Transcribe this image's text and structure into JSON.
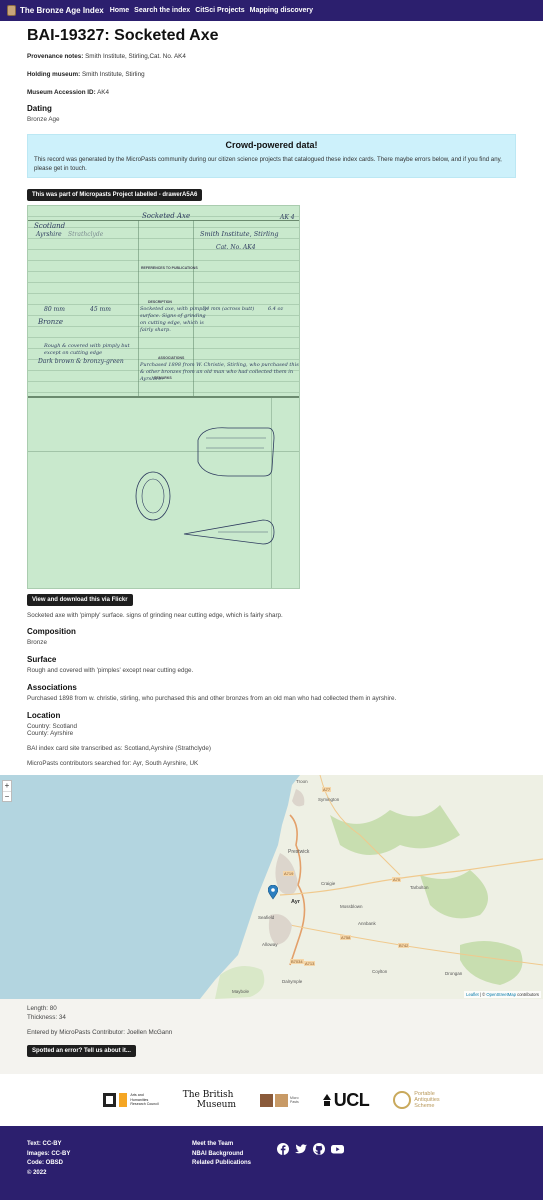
{
  "navbar": {
    "brand": "The Bronze Age Index",
    "links": [
      "Home",
      "Search the index",
      "CitSci Projects",
      "Mapping discovery"
    ]
  },
  "record": {
    "title": "BAI-19327: Socketed Axe",
    "provenance_label": "Provenance notes:",
    "provenance_value": "Smith Institute, Stirling,Cat. No. AK4",
    "holding_label": "Holding museum:",
    "holding_value": "Smith Institute, Stirling",
    "accession_label": "Museum Accession ID:",
    "accession_value": "AK4",
    "dating_heading": "Dating",
    "dating_value": "Bronze Age"
  },
  "crowd": {
    "heading": "Crowd-powered data!",
    "text": "This record was generated by the MicroPasts community during our citizen science projects that catalogued these index cards. There maybe errors below, and if you find any, please get in touch."
  },
  "project_badge": "This was part of Micropasts Project labelled - drawerA5A6",
  "card": {
    "country": "Scotland",
    "county": "Ayrshire",
    "county2": "Strathclyde",
    "type": "Socketed Axe",
    "collection": "Smith Institute, Stirling",
    "catno": "Cat. No. AK4",
    "refs_heading": "REFERENCES TO PUBLICATIONS",
    "description_heading": "DESCRIPTION",
    "length": "80 mm",
    "width": "45 mm",
    "composition": "Bronze",
    "description": "Socketed axe, with pimply surface. Signs of grinding on cutting edge, which is fairly sharp.",
    "associations_heading": "ASSOCIATIONS",
    "associations": "Purchased 1898 from W. Christie, Stirling, who purchased this & other bronzes from an old man who had collected them in Ayrshire.",
    "remarks_heading": "REMARKS",
    "colour": "Dark brown & bronzy-green",
    "surface": "Rough & covered with pimply but except on cutting edge",
    "corner": "AK 4"
  },
  "flickr_button": "View and download this via Flickr",
  "summary": "Socketed axe with 'pimply' surface. signs of grinding near cutting edge, which is fairly sharp.",
  "composition": {
    "heading": "Composition",
    "value": "Bronze"
  },
  "surface": {
    "heading": "Surface",
    "value": "Rough and covered with 'pimples' except near cutting edge."
  },
  "associations": {
    "heading": "Associations",
    "value": "Purchased 1898 from w. christie, stirling, who purchased this and other bronzes from an old man who had collected them in ayrshire."
  },
  "location": {
    "heading": "Location",
    "country": "Country: Scotland",
    "county": "County: Ayrshire",
    "transcribed": "BAI index card site transcribed as: Scotland,Ayrshire (Strathclyde)",
    "searched": "MicroPasts contributors searched for: Ayr, South Ayrshire, UK"
  },
  "map": {
    "zoom_in": "+",
    "zoom_out": "−",
    "attribution_leaflet": "Leaflet",
    "attribution_osm": "OpenStreetMap",
    "attribution_tail": "contributors",
    "places": [
      "Prestwick",
      "Ayr",
      "Craigie",
      "Alloway",
      "Annbank",
      "Mossblown",
      "Tarbolton",
      "Drongan",
      "Coylton",
      "Dalrymple",
      "Maybole",
      "Symington",
      "Troon",
      "Seafield"
    ],
    "roads": [
      "A77",
      "A719",
      "A70",
      "B742",
      "A758",
      "B7034",
      "A713"
    ]
  },
  "measurements": {
    "length": "Length: 80",
    "thickness": "Thickness: 34",
    "contributor": "Entered by MicroPasts Contributor: Joellen McGann",
    "error_button": "Spotted an error? Tell us about it..."
  },
  "partners": {
    "ahrc_line1": "Arts and",
    "ahrc_line2": "Humanities",
    "ahrc_line3": "Research Council",
    "bm_line1": "The British",
    "bm_line2": "Museum",
    "micropasts_line1": "Micro",
    "micropasts_line2": "Pasts",
    "ucl": "UCL",
    "pas_line1": "Portable",
    "pas_line2": "Antiquities",
    "pas_line3": "Scheme"
  },
  "footer": {
    "col1": [
      "Text: CC-BY",
      "Images: CC-BY",
      "Code: OBSD",
      "© 2022"
    ],
    "col2": [
      "Meet the Team",
      "NBAI Background",
      "Related Publications"
    ]
  },
  "colors": {
    "nav": "#2c1f6e",
    "alert_bg": "#cdf1fb",
    "card_bg": "#c9e9cd",
    "button": "#1e1e1e"
  }
}
